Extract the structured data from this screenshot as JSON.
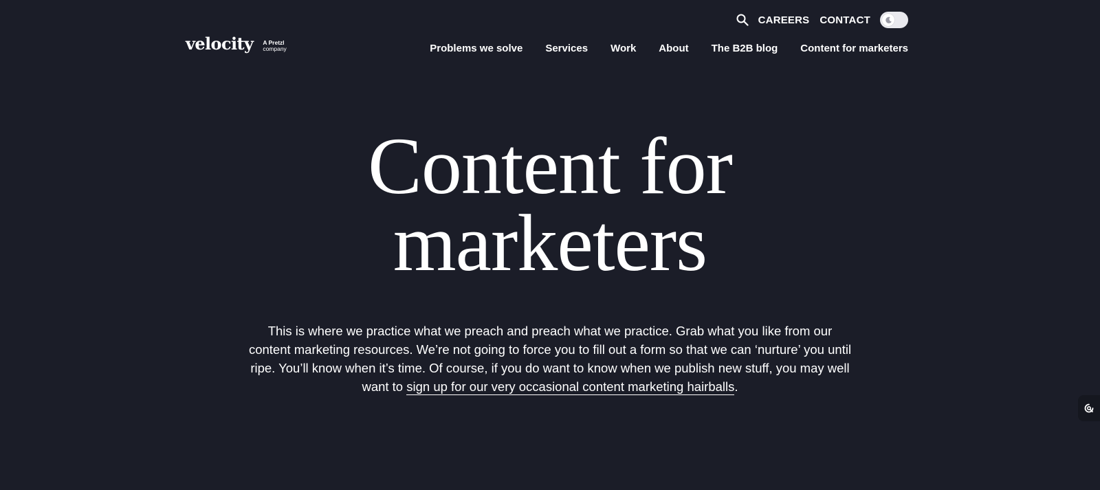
{
  "header": {
    "utility": {
      "search_icon": "search-icon",
      "careers_label": "CAREERS",
      "contact_label": "CONTACT",
      "theme_toggle_icon": "moon-icon"
    },
    "logo": {
      "wordmark": "velocity",
      "tag_line1": "A Pretzl",
      "tag_line2": "company"
    },
    "nav": [
      {
        "label": "Problems we solve"
      },
      {
        "label": "Services"
      },
      {
        "label": "Work"
      },
      {
        "label": "About"
      },
      {
        "label": "The B2B blog"
      },
      {
        "label": "Content for marketers"
      }
    ]
  },
  "hero": {
    "title_line1": "Content for",
    "title_line2": "marketers",
    "intro_text": "This is where we practice what we preach and preach what we practice. Grab what you like from our content marketing resources. We’re not going to force you to fill out a form so that we can ‘nurture’ you until ripe. You’ll know when it’s time. Of course, if you do want to know when we publish new stuff, you may well want to ",
    "signup_link": "sign up for our very occasional content marketing hairballs",
    "trailing_punctuation": "."
  },
  "side_widget": {
    "icon": "chat-widget-icon"
  },
  "colors": {
    "background": "#1b1d28",
    "text": "#ffffff",
    "toggle_track": "#e9e9ee"
  }
}
